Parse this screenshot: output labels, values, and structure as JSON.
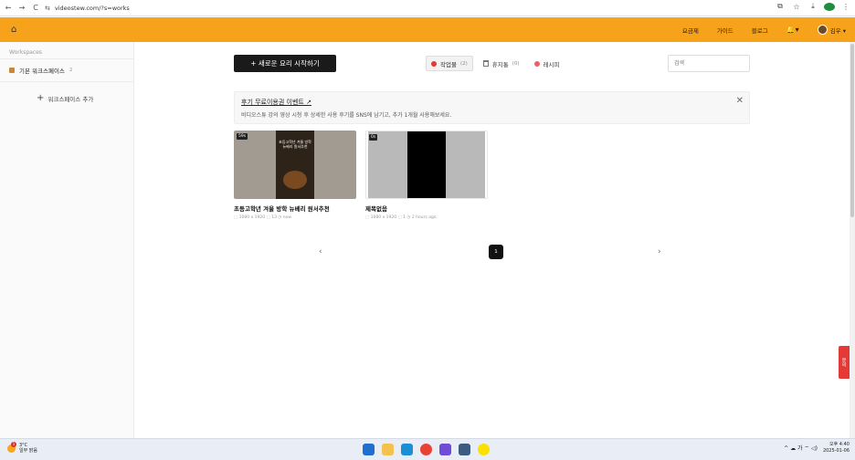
{
  "browser": {
    "url": "videostew.com/?s=works",
    "back": "←",
    "forward": "→",
    "reload": "C",
    "site_info": "⇆",
    "right_icons": [
      "⧉",
      "☆",
      "⤓",
      "⋮"
    ]
  },
  "header": {
    "home_icon": "⌂",
    "nav": [
      "요금제",
      "가이드",
      "블로그"
    ],
    "bell": "🔔▾",
    "user_name": "김우 ▾",
    "brand_color": "#f7a21b"
  },
  "sidebar": {
    "title": "Workspaces",
    "workspace": {
      "name": "기본 워크스페이스",
      "count": "2"
    },
    "add_label": "워크스페이스 추가",
    "add_icon": "+"
  },
  "main": {
    "new_button": "+ 새로운 요리 시작하기",
    "tabs": [
      {
        "label": "작업물",
        "count": "(2)",
        "active": true
      },
      {
        "label": "휴지통",
        "count": "(0)",
        "active": false
      },
      {
        "label": "레시피",
        "count": "",
        "active": false
      }
    ],
    "search_placeholder": "검색"
  },
  "notice": {
    "title": "후기 무료이용권 이벤트 ↗",
    "desc": "비디오스튜 강의 영상 시청 후 상세한 사용 후기를 SNS에 남기고, 추가 1개월 사용해보세요.",
    "close": "✕"
  },
  "cards": [
    {
      "duration": "59s",
      "thumb_text": "초등고학년 겨울 방학 뉴베리 원서추천",
      "title": "초등고학년 겨울 방학 뉴베리 원서추천",
      "meta": "⬚ 1080 x 1920  ⬚ 13  ◷ now"
    },
    {
      "duration": "0s",
      "thumb_text": "",
      "title": "제목없음",
      "meta": "⬚ 1080 x 1920  ⬚ 1  ◷ 2 hours ago"
    }
  ],
  "pager": {
    "prev": "‹",
    "current": "1",
    "next": "›"
  },
  "float_button": "문의",
  "taskbar": {
    "weather_temp": "3°C",
    "weather_desc": "일부 맑음",
    "weather_badge": "1",
    "tray_text": "^ ☁ 가 ⌔ ◁)",
    "time": "오후 4:40",
    "date": "2025-01-06"
  }
}
